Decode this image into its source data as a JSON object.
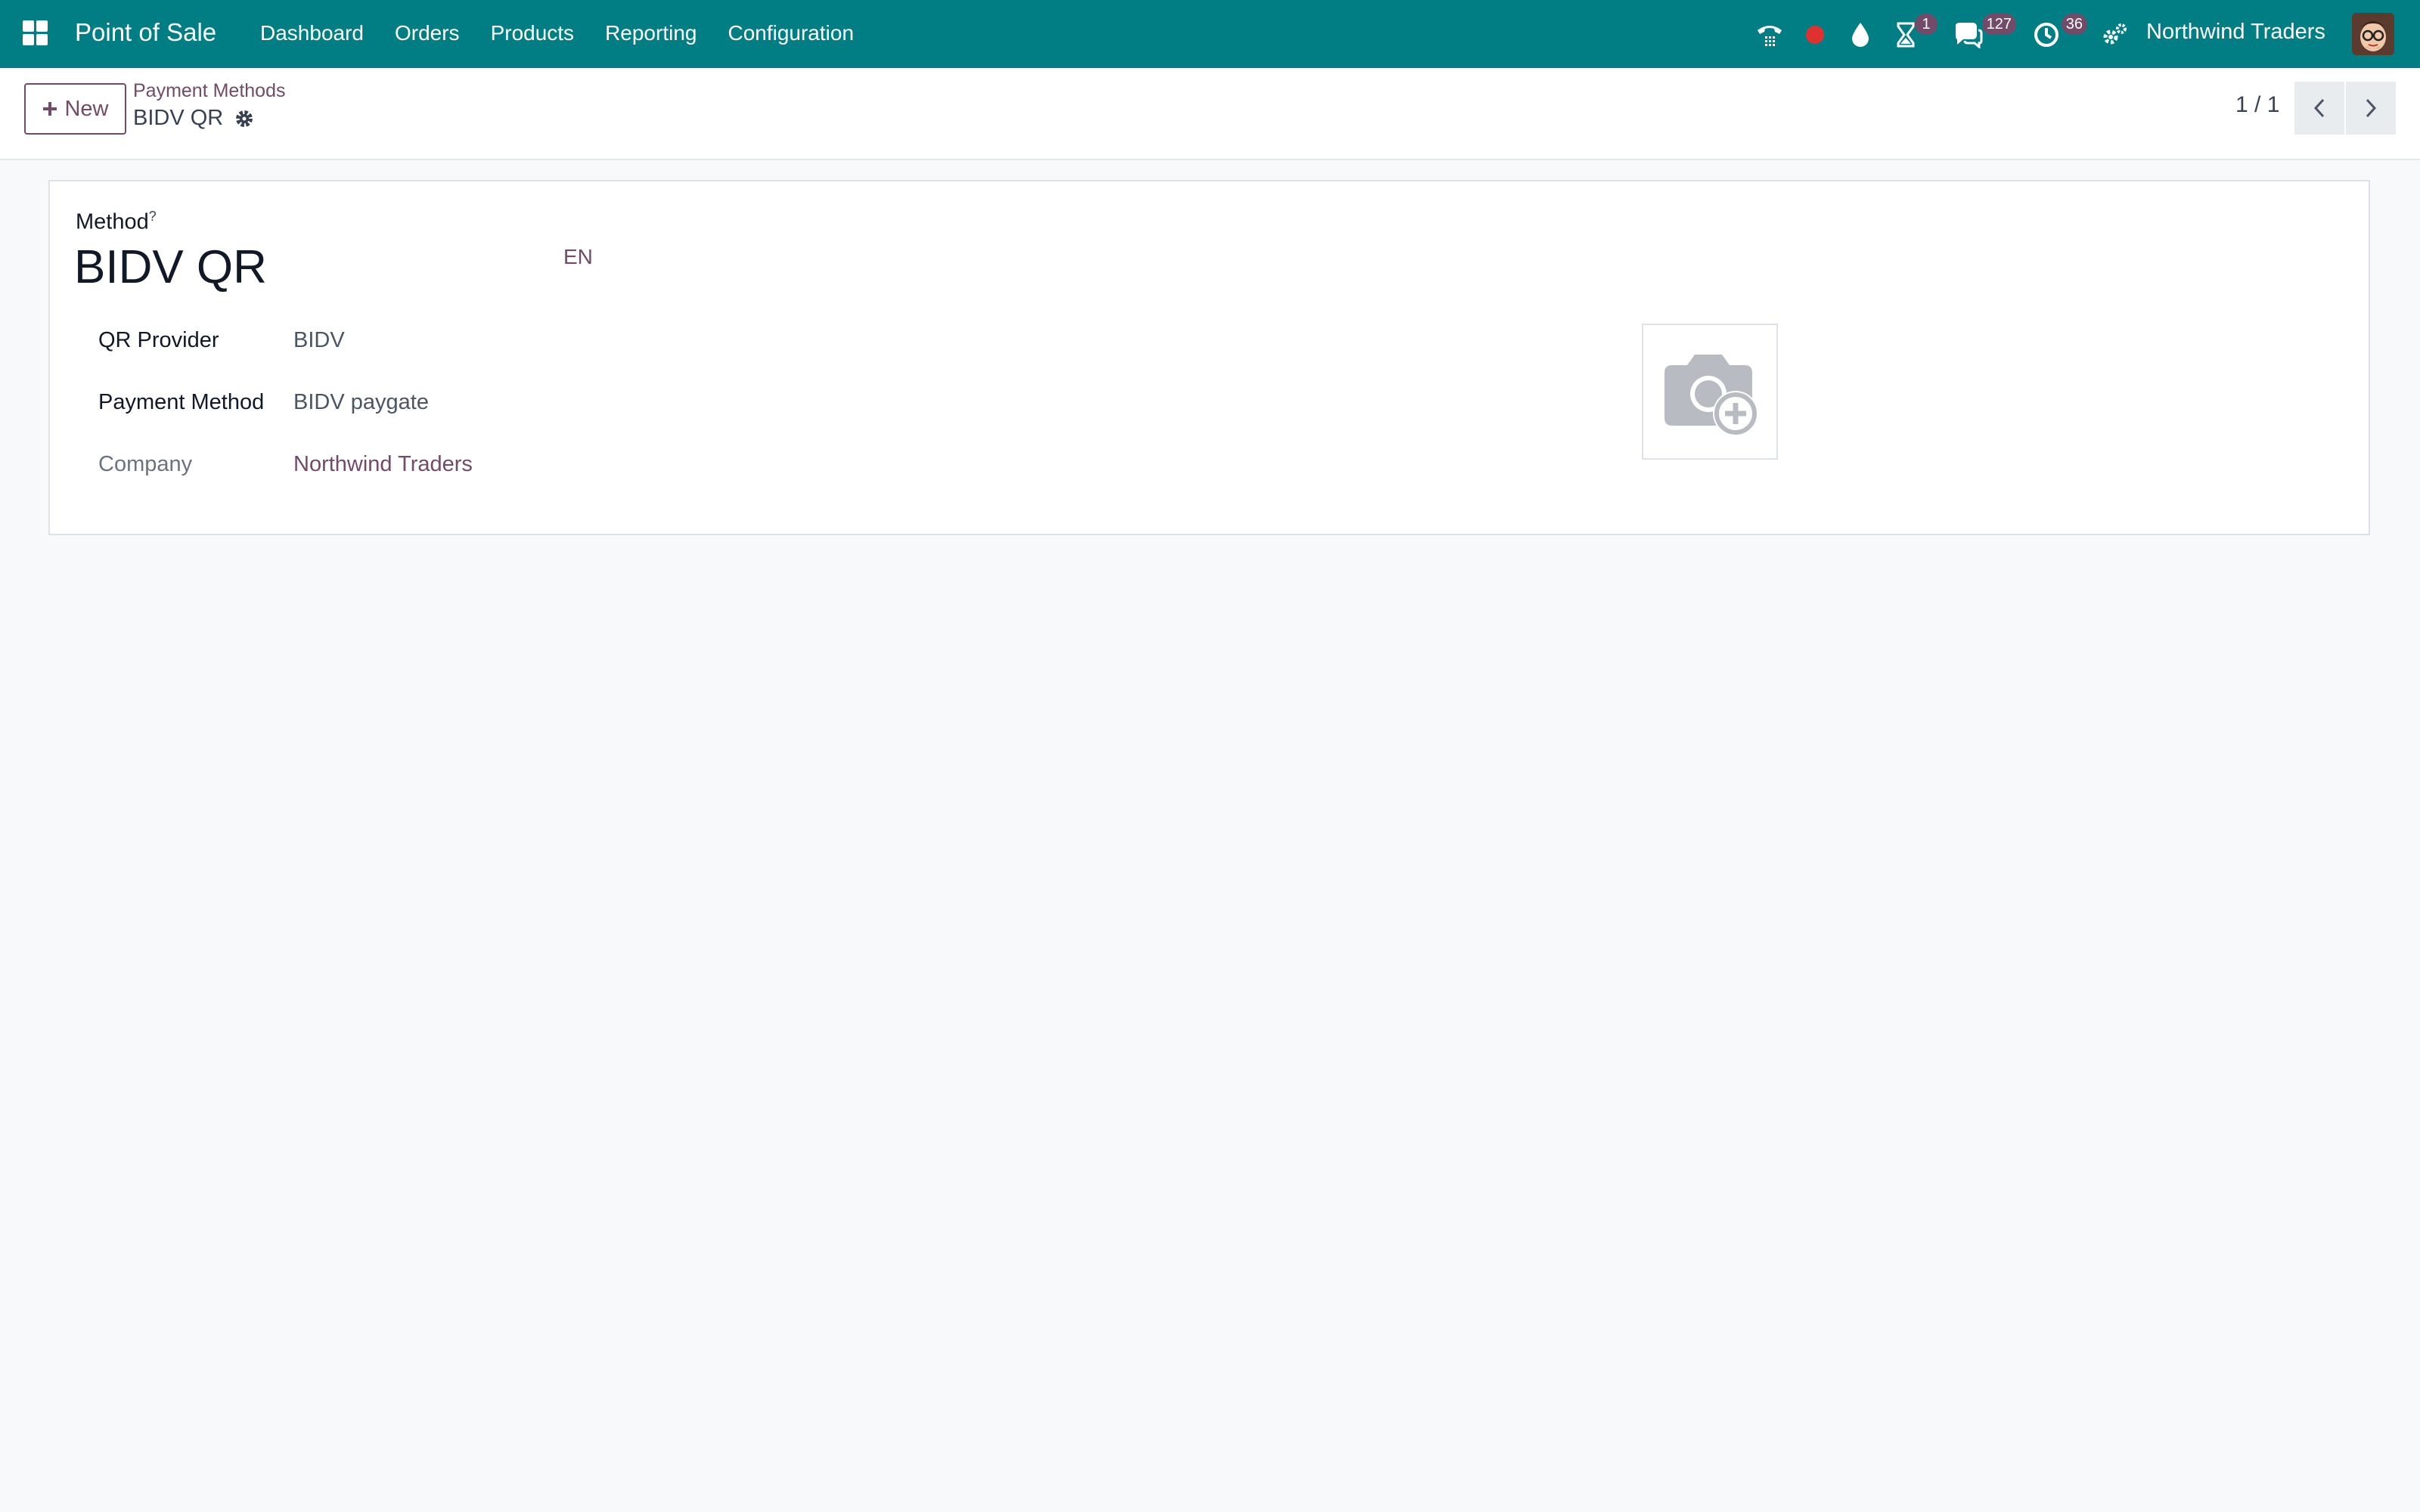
{
  "navbar": {
    "app_name": "Point of Sale",
    "menu": [
      {
        "label": "Dashboard"
      },
      {
        "label": "Orders"
      },
      {
        "label": "Products"
      },
      {
        "label": "Reporting"
      },
      {
        "label": "Configuration"
      }
    ],
    "systray": {
      "activity_badge": "1",
      "messages_badge": "127",
      "clock_badge": "36",
      "company": "Northwind Traders"
    }
  },
  "control_panel": {
    "new_label": "New",
    "breadcrumb_parent": "Payment Methods",
    "breadcrumb_current": "BIDV QR",
    "pager": "1 / 1"
  },
  "form": {
    "method_label": "Method",
    "method_help": "?",
    "title": "BIDV QR",
    "lang": "EN",
    "fields": {
      "qr_provider_label": "QR Provider",
      "qr_provider_value": "BIDV",
      "payment_method_label": "Payment Method",
      "payment_method_value": "BIDV paygate",
      "company_label": "Company",
      "company_value": "Northwind Traders"
    }
  },
  "colors": {
    "navbar": "#017e84",
    "accent": "#714b67",
    "recording_dot": "#e03131"
  }
}
